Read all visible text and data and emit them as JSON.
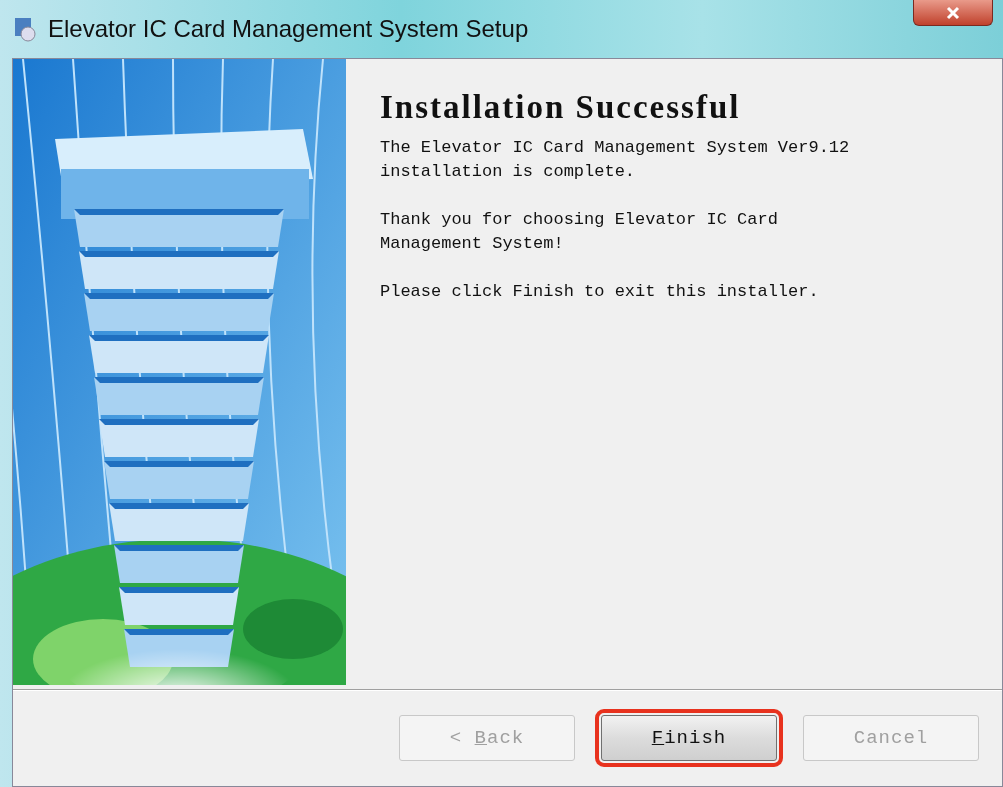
{
  "window": {
    "title": "Elevator IC Card Management System Setup"
  },
  "page": {
    "heading": "Installation Successful",
    "paragraphs": [
      "The Elevator IC Card Management System Ver9.12 installation is complete.",
      "Thank you for choosing Elevator IC Card Management System!",
      "Please click Finish to exit this installer."
    ]
  },
  "buttons": [
    {
      "prefix": "< ",
      "mnemonic": "B",
      "rest": "ack",
      "disabled": true,
      "highlighted": false
    },
    {
      "mnemonic": "F",
      "rest": "inish",
      "disabled": false,
      "highlighted": true
    },
    {
      "rest": "Cancel",
      "disabled": true,
      "highlighted": false
    }
  ]
}
